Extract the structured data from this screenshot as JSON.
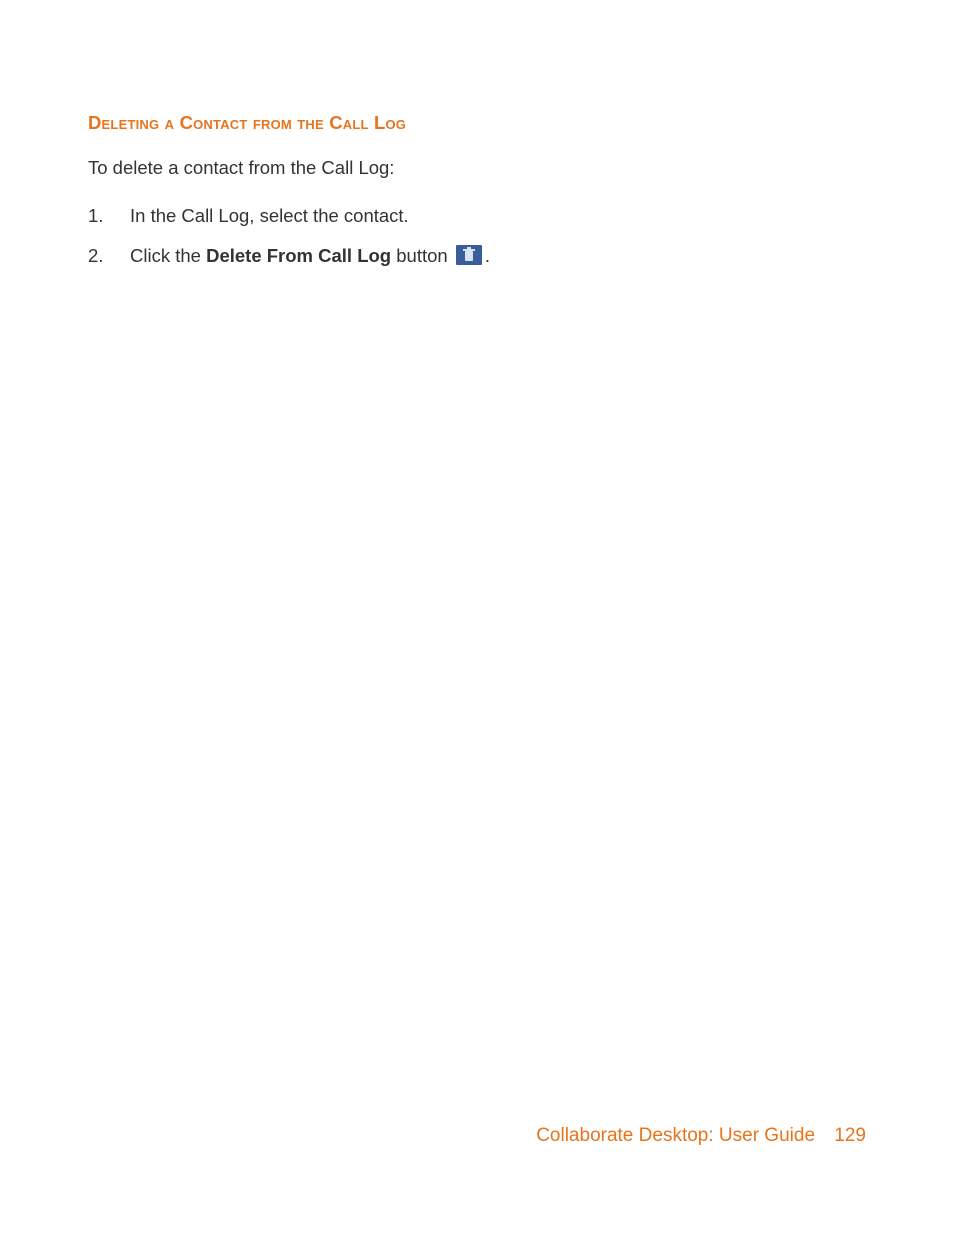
{
  "heading": "Deleting a Contact from the Call Log",
  "intro": "To delete a contact from the Call Log:",
  "steps": [
    {
      "num": "1.",
      "parts": [
        {
          "text": "In the Call Log, select the contact.",
          "bold": false
        }
      ]
    },
    {
      "num": "2.",
      "parts": [
        {
          "text": "Click the ",
          "bold": false
        },
        {
          "text": "Delete From Call Log",
          "bold": true
        },
        {
          "text": " button ",
          "bold": false
        },
        {
          "icon": "delete-from-call-log-icon"
        },
        {
          "text": ".",
          "bold": false
        }
      ]
    }
  ],
  "footer": {
    "title": "Collaborate Desktop: User Guide",
    "page": "129"
  }
}
